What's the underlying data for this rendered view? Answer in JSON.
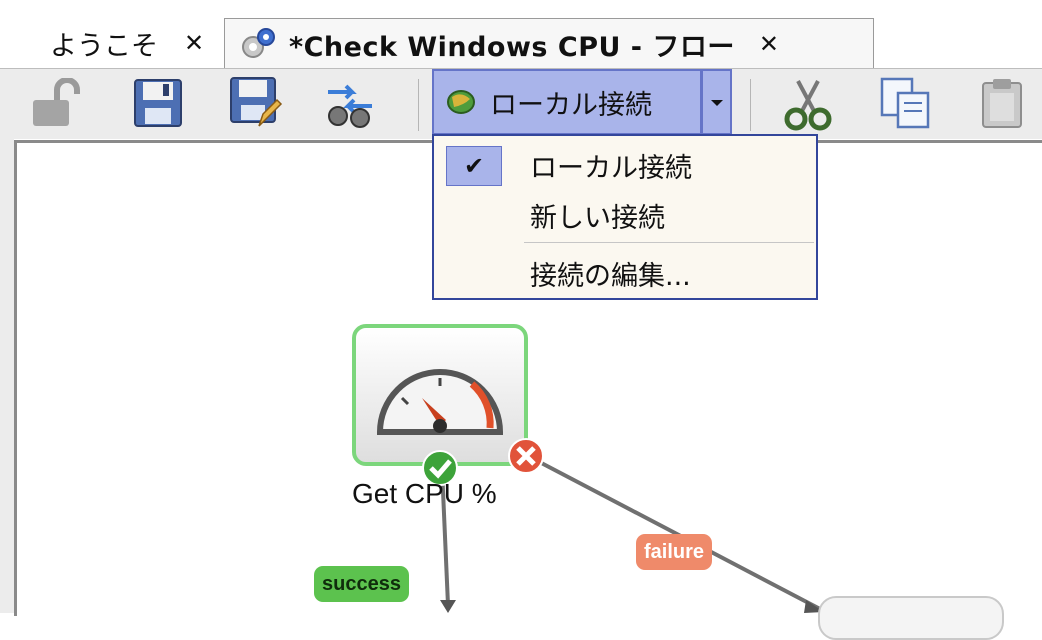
{
  "tabs": [
    {
      "label": "ようこそ",
      "close": "✕"
    },
    {
      "label": "*Check Windows CPU - フロー",
      "close": "✕"
    }
  ],
  "toolbar": {
    "connection_label": "ローカル接続"
  },
  "menu": {
    "items": [
      {
        "label": "ローカル接続",
        "checked": true,
        "check": "✔"
      },
      {
        "label": "新しい接続"
      },
      {
        "label": "接続の編集..."
      }
    ]
  },
  "flow": {
    "node_label": "Get CPU %",
    "success_label": "success",
    "failure_label": "failure"
  },
  "colors": {
    "accent": "#a9b4ea",
    "accent_border": "#6574c8",
    "menu_border": "#33469b",
    "node_border": "#7cd67c",
    "success": "#5cc24e",
    "failure": "#ef8a6a"
  }
}
